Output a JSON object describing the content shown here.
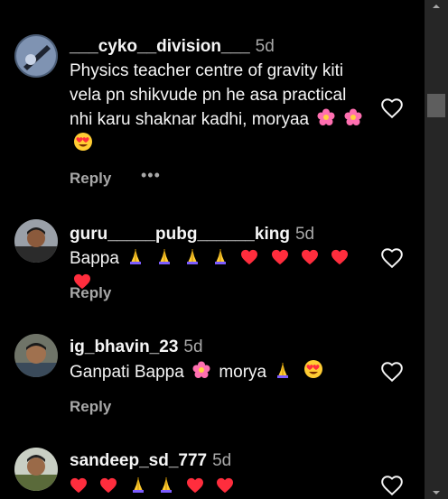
{
  "comments": [
    {
      "username": "___cyko__division___",
      "time": "5d",
      "text": "Physics teacher centre of gravity kiti vela pn shikvude pn he asa practical nhi karu shaknar kadhi, moryaa",
      "reply_label": "Reply",
      "more_label": "•••",
      "emojis": [
        "flower",
        "flower",
        "heart-eyes"
      ]
    },
    {
      "username": "guru_____pubg______king",
      "time": "5d",
      "text": "Bappa",
      "reply_label": "Reply",
      "emojis": [
        "pray",
        "pray",
        "pray",
        "pray",
        "red-heart",
        "red-heart",
        "red-heart",
        "red-heart",
        "red-heart"
      ]
    },
    {
      "username": "ig_bhavin_23",
      "time": "5d",
      "text_before": "Ganpati Bappa",
      "text_after": "morya",
      "reply_label": "Reply",
      "emojis": [
        "flower",
        "pray",
        "heart-eyes"
      ]
    },
    {
      "username": "sandeep_sd_777",
      "time": "5d",
      "emojis": [
        "red-heart",
        "red-heart",
        "pray",
        "pray",
        "red-heart",
        "red-heart"
      ]
    }
  ],
  "colors": {
    "background": "#000000",
    "text": "#f5f5f5",
    "secondary": "#a8a8a8",
    "heart": "#ff2d3d",
    "scrollbar": "#262626"
  },
  "icons": [
    "heart-outline-icon",
    "scroll-up-arrow",
    "scroll-down-arrow"
  ]
}
